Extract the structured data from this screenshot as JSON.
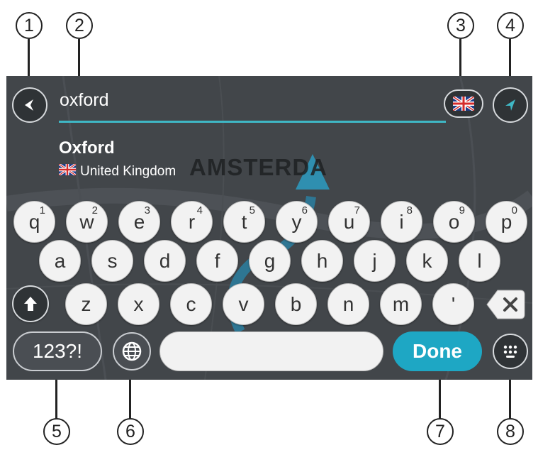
{
  "callouts": [
    "1",
    "2",
    "3",
    "4",
    "5",
    "6",
    "7",
    "8"
  ],
  "search": {
    "query": "oxford"
  },
  "result": {
    "name": "Oxford",
    "country": "United Kingdom"
  },
  "map": {
    "label": "AMSTERDA"
  },
  "keyboard": {
    "row1": [
      {
        "key": "q",
        "sup": "1"
      },
      {
        "key": "w",
        "sup": "2"
      },
      {
        "key": "e",
        "sup": "3"
      },
      {
        "key": "r",
        "sup": "4"
      },
      {
        "key": "t",
        "sup": "5"
      },
      {
        "key": "y",
        "sup": "6"
      },
      {
        "key": "u",
        "sup": "7"
      },
      {
        "key": "i",
        "sup": "8"
      },
      {
        "key": "o",
        "sup": "9"
      },
      {
        "key": "p",
        "sup": "0"
      }
    ],
    "row2": [
      "a",
      "s",
      "d",
      "f",
      "g",
      "h",
      "j",
      "k",
      "l"
    ],
    "row3": [
      "z",
      "x",
      "c",
      "v",
      "b",
      "n",
      "m",
      "'"
    ],
    "symbols_label": "123?!",
    "done_label": "Done"
  },
  "colors": {
    "accent": "#3fb7c5",
    "done": "#1ea7c4",
    "key": "#f2f2f2",
    "screen": "#3f4348"
  },
  "icons": [
    "back-arrow-icon",
    "uk-flag-icon",
    "navigation-arrow-icon",
    "shift-arrow-icon",
    "backspace-icon",
    "globe-icon",
    "keyboard-dots-icon"
  ]
}
